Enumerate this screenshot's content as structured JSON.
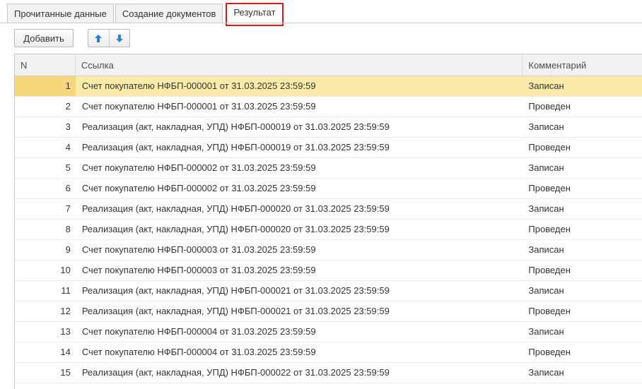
{
  "tabs": [
    {
      "label": "Прочитанные данные"
    },
    {
      "label": "Создание документов"
    },
    {
      "label": "Результат"
    }
  ],
  "toolbar": {
    "add_label": "Добавить",
    "move_up_icon": "arrow-up-icon",
    "move_down_icon": "arrow-down-icon"
  },
  "colors": {
    "selected_row": "#fbeaa8",
    "active_tab_border": "#e0191b",
    "arrow_blue": "#2f7fd6"
  },
  "table": {
    "columns": [
      "N",
      "Ссылка",
      "Комментарий"
    ],
    "selected_row": 1,
    "rows": [
      {
        "n": "1",
        "link": "Счет покупателю НФБП-000001 от 31.03.2025 23:59:59",
        "comment": "Записан"
      },
      {
        "n": "2",
        "link": "Счет покупателю НФБП-000001 от 31.03.2025 23:59:59",
        "comment": "Проведен"
      },
      {
        "n": "3",
        "link": "Реализация (акт, накладная, УПД) НФБП-000019 от 31.03.2025 23:59:59",
        "comment": "Записан"
      },
      {
        "n": "4",
        "link": "Реализация (акт, накладная, УПД) НФБП-000019 от 31.03.2025 23:59:59",
        "comment": "Проведен"
      },
      {
        "n": "5",
        "link": "Счет покупателю НФБП-000002 от 31.03.2025 23:59:59",
        "comment": "Записан"
      },
      {
        "n": "6",
        "link": "Счет покупателю НФБП-000002 от 31.03.2025 23:59:59",
        "comment": "Проведен"
      },
      {
        "n": "7",
        "link": "Реализация (акт, накладная, УПД) НФБП-000020 от 31.03.2025 23:59:59",
        "comment": "Записан"
      },
      {
        "n": "8",
        "link": "Реализация (акт, накладная, УПД) НФБП-000020 от 31.03.2025 23:59:59",
        "comment": "Проведен"
      },
      {
        "n": "9",
        "link": "Счет покупателю НФБП-000003 от 31.03.2025 23:59:59",
        "comment": "Записан"
      },
      {
        "n": "10",
        "link": "Счет покупателю НФБП-000003 от 31.03.2025 23:59:59",
        "comment": "Проведен"
      },
      {
        "n": "11",
        "link": "Реализация (акт, накладная, УПД) НФБП-000021 от 31.03.2025 23:59:59",
        "comment": "Записан"
      },
      {
        "n": "12",
        "link": "Реализация (акт, накладная, УПД) НФБП-000021 от 31.03.2025 23:59:59",
        "comment": "Проведен"
      },
      {
        "n": "13",
        "link": "Счет покупателю НФБП-000004 от 31.03.2025 23:59:59",
        "comment": "Записан"
      },
      {
        "n": "14",
        "link": "Счет покупателю НФБП-000004 от 31.03.2025 23:59:59",
        "comment": "Проведен"
      },
      {
        "n": "15",
        "link": "Реализация (акт, накладная, УПД) НФБП-000022 от 31.03.2025 23:59:59",
        "comment": "Записан"
      }
    ]
  }
}
